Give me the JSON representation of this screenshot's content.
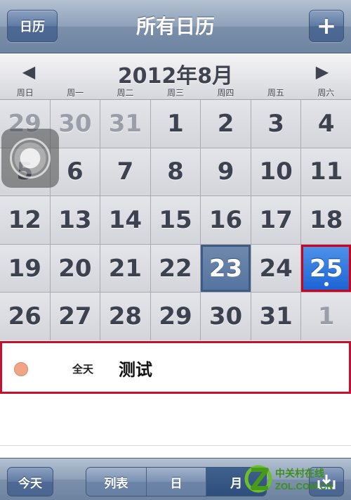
{
  "nav": {
    "left_button": "日历",
    "title": "所有日历",
    "right_button": "+"
  },
  "month": {
    "title": "2012年8月",
    "prev_icon": "◀",
    "next_icon": "▶",
    "weekdays": [
      "周日",
      "周一",
      "周二",
      "周三",
      "周四",
      "周五",
      "周六"
    ]
  },
  "calendar": {
    "rows": [
      [
        {
          "d": "29",
          "t": "other"
        },
        {
          "d": "30",
          "t": "other"
        },
        {
          "d": "31",
          "t": "other"
        },
        {
          "d": "1"
        },
        {
          "d": "2"
        },
        {
          "d": "3"
        },
        {
          "d": "4"
        }
      ],
      [
        {
          "d": "5"
        },
        {
          "d": "6"
        },
        {
          "d": "7"
        },
        {
          "d": "8"
        },
        {
          "d": "9"
        },
        {
          "d": "10"
        },
        {
          "d": "11"
        }
      ],
      [
        {
          "d": "12"
        },
        {
          "d": "13"
        },
        {
          "d": "14"
        },
        {
          "d": "15"
        },
        {
          "d": "16"
        },
        {
          "d": "17"
        },
        {
          "d": "18"
        }
      ],
      [
        {
          "d": "19"
        },
        {
          "d": "20"
        },
        {
          "d": "21"
        },
        {
          "d": "22"
        },
        {
          "d": "23",
          "t": "selected"
        },
        {
          "d": "24"
        },
        {
          "d": "25",
          "t": "today",
          "dot": true
        }
      ],
      [
        {
          "d": "26"
        },
        {
          "d": "27"
        },
        {
          "d": "28"
        },
        {
          "d": "29"
        },
        {
          "d": "30"
        },
        {
          "d": "31"
        },
        {
          "d": "1",
          "t": "other"
        }
      ]
    ]
  },
  "events": [
    {
      "time": "全天",
      "title": "测试",
      "color": "#f0a585"
    }
  ],
  "toolbar": {
    "today": "今天",
    "segments": [
      {
        "label": "列表",
        "active": false
      },
      {
        "label": "日",
        "active": false
      },
      {
        "label": "月",
        "active": true
      }
    ]
  },
  "watermark": {
    "line1": "中关村在线",
    "line2": "ZOL.COM.CN"
  }
}
